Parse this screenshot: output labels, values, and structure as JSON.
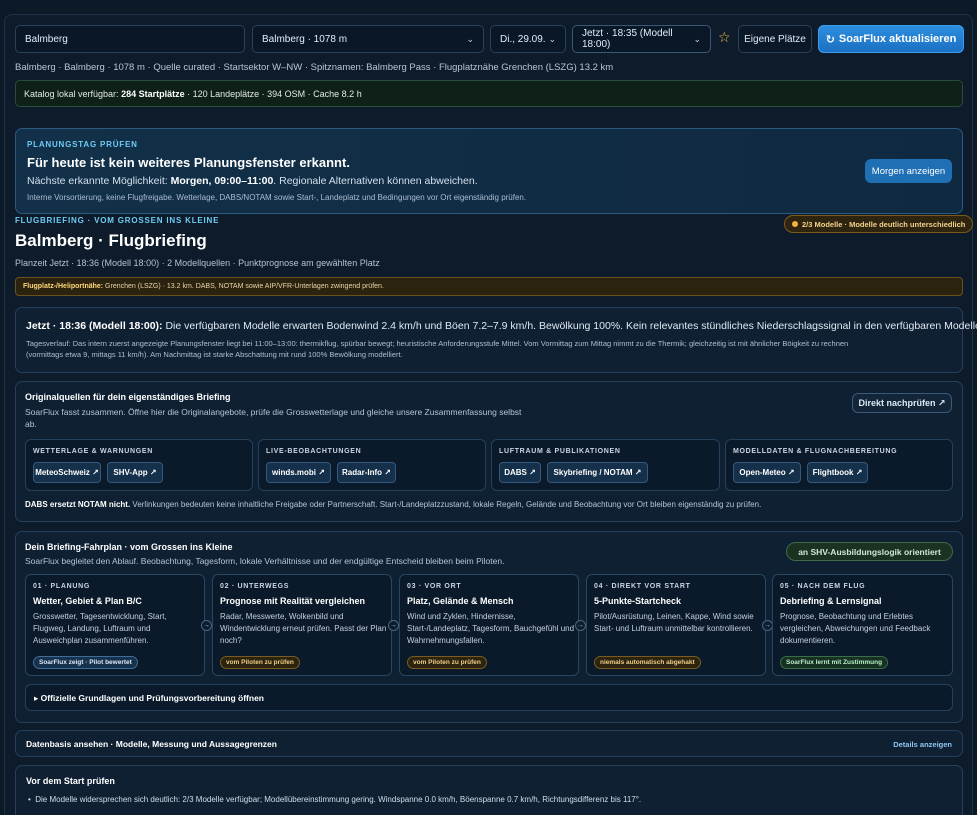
{
  "controls": {
    "location_input": "Balmberg",
    "site_select": "Balmberg · 1078 m",
    "date_select": "Di., 29.09.",
    "time_select": "Jetzt · 18:35 (Modell 18:00)",
    "own_places": "Eigene Plätze",
    "refresh_icon": "↻",
    "refresh": "SoarFlux aktualisieren",
    "chevron": "⌄",
    "star": "☆"
  },
  "meta_line": "Balmberg · Balmberg · 1078 m · Quelle curated · Startsektor W–NW · Spitznamen: Balmberg Pass · Flugplatznähe Grenchen (LSZG) 13.2 km",
  "catalog": {
    "prefix": "Katalog lokal verfügbar: ",
    "bold": "284 Startplätze",
    "rest": " · 120 Landeplätze · 394 OSM · Cache 8.2 h"
  },
  "planning": {
    "kicker": "Planungstag prüfen",
    "title": "Für heute ist kein weiteres Planungsfenster erkannt.",
    "text_prefix": "Nächste erkannte Möglichkeit: ",
    "text_bold": "Morgen, 09:00–11:00",
    "text_suffix": ". Regionale Alternativen können abweichen.",
    "small": "Interne Vorsortierung, keine Flugfreigabe. Wetterlage, DABS/NOTAM sowie Start-, Landeplatz und Bedingungen vor Ort eigenständig prüfen.",
    "button": "Morgen anzeigen"
  },
  "briefing": {
    "kicker": "Flugbriefing · vom Grossen ins Kleine",
    "title": "Balmberg · Flugbriefing",
    "subtitle": "Planzeit Jetzt · 18:36 (Modell 18:00) · 2 Modellquellen · Punktprognose am gewählten Platz",
    "model_pill": "2/3 Modelle · Modelle deutlich unterschiedlich",
    "heli_bold": "Flugplatz-/Heliportnähe:",
    "heli_text": " Grenchen (LSZG) · 13.2 km. DABS, NOTAM sowie AIP/VFR-Unterlagen zwingend prüfen."
  },
  "now": {
    "bold": "Jetzt · 18:36 (Modell 18:00):",
    "text": " Die verfügbaren Modelle erwarten Bodenwind 2.4 km/h und Böen 7.2–7.9 km/h. Bewölkung 100%. Kein relevantes stündliches Niederschlagssignal in den verfügbaren Modellen.",
    "detail_1": "Tagesverlauf: Das intern zuerst angezeigte Planungsfenster liegt bei 11:00–13:00: thermikflug, spürbar bewegt; heuristische Anforderungsstufe Mittel. Vom Vormittag zum Mittag nimmt zu die Thermik; gleichzeitig ist mit ähnlicher Böigkeit zu rechnen",
    "detail_2": "(vormittags etwa 9, mittags 11 km/h). Am Nachmittag ist starke Abschattung mit rund 100% Bewölkung modelliert."
  },
  "sources": {
    "title": "Originalquellen für dein eigenständiges Briefing",
    "desc_1": "SoarFlux fasst zusammen. Öffne hier die Originalangebote, prüfe die Grosswetterlage und gleiche unsere Zusammenfassung selbst",
    "desc_2": "ab.",
    "direct_button": "Direkt nachprüfen ↗",
    "groups": [
      {
        "kicker": "Wetterlage & Warnungen",
        "chips": [
          "MeteoSchweiz ↗",
          "SHV-App ↗"
        ]
      },
      {
        "kicker": "Live-Beobachtungen",
        "chips": [
          "winds.mobi ↗",
          "Radar-Info ↗"
        ]
      },
      {
        "kicker": "Luftraum & Publikationen",
        "chips": [
          "DABS ↗",
          "Skybriefing / NOTAM ↗"
        ]
      },
      {
        "kicker": "Modelldaten & Flugnachbereitung",
        "chips": [
          "Open-Meteo ↗",
          "Flightbook ↗"
        ]
      }
    ],
    "foot_bold": "DABS ersetzt NOTAM nicht.",
    "foot_text": " Verlinkungen bedeuten keine inhaltliche Freigabe oder Partnerschaft. Start-/Landeplatzzustand, lokale Regeln, Gelände und Beobachtung vor Ort bleiben eigenständig zu prüfen."
  },
  "roadmap": {
    "title": "Dein Briefing-Fahrplan · vom Grossen ins Kleine",
    "desc": "SoarFlux begleitet den Ablauf. Beobachtung, Tagesform, lokale Verhältnisse und der endgültige Entscheid bleiben beim Piloten.",
    "pill": "an SHV-Ausbildungslogik orientiert",
    "arrow": "→",
    "steps": [
      {
        "kicker": "01 · Planung",
        "title": "Wetter, Gebiet & Plan B/C",
        "text": "Grosswetter, Tagesentwicklung, Start, Flugweg, Landung, Luftraum und Ausweichplan zusammenführen.",
        "tag": "SoarFlux zeigt · Pilot bewertet",
        "tag_style": "blue"
      },
      {
        "kicker": "02 · Unterwegs",
        "title": "Prognose mit Realität vergleichen",
        "text": "Radar, Messwerte, Wolkenbild und Windentwicklung erneut prüfen. Passt der Plan noch?",
        "tag": "vom Piloten zu prüfen",
        "tag_style": "amber"
      },
      {
        "kicker": "03 · Vor Ort",
        "title": "Platz, Gelände & Mensch",
        "text": "Wind und Zyklen, Hindernisse, Start-/Landeplatz, Tagesform, Bauchgefühl und Wahrnehmungsfallen.",
        "tag": "vom Piloten zu prüfen",
        "tag_style": "amber"
      },
      {
        "kicker": "04 · Direkt vor Start",
        "title": "5-Punkte-Startcheck",
        "text": "Pilot/Ausrüstung, Leinen, Kappe, Wind sowie Start- und Luftraum unmittelbar kontrollieren.",
        "tag": "niemals automatisch abgehakt",
        "tag_style": "amber"
      },
      {
        "kicker": "05 · Nach dem Flug",
        "title": "Debriefing & Lernsignal",
        "text": "Prognose, Beobachtung und Erlebtes vergleichen, Abweichungen und Feedback dokumentieren.",
        "tag": "SoarFlux lernt mit Zustimmung",
        "tag_style": "green"
      }
    ],
    "details_toggle": "▸ Offizielle Grundlagen und Prüfungsvorbereitung öffnen"
  },
  "database": {
    "title": "Datenbasis ansehen · Modelle, Messung und Aussagegrenzen",
    "link": "Details anzeigen"
  },
  "prestart": {
    "title": "Vor dem Start prüfen",
    "bullet_1": "Die Modelle widersprechen sich deutlich: 2/3 Modelle verfügbar; Modellübereinstimmung gering. Windspanne 0.0 km/h, Böenspanne 0.7 km/h, Richtungsdifferenz bis 117°."
  }
}
